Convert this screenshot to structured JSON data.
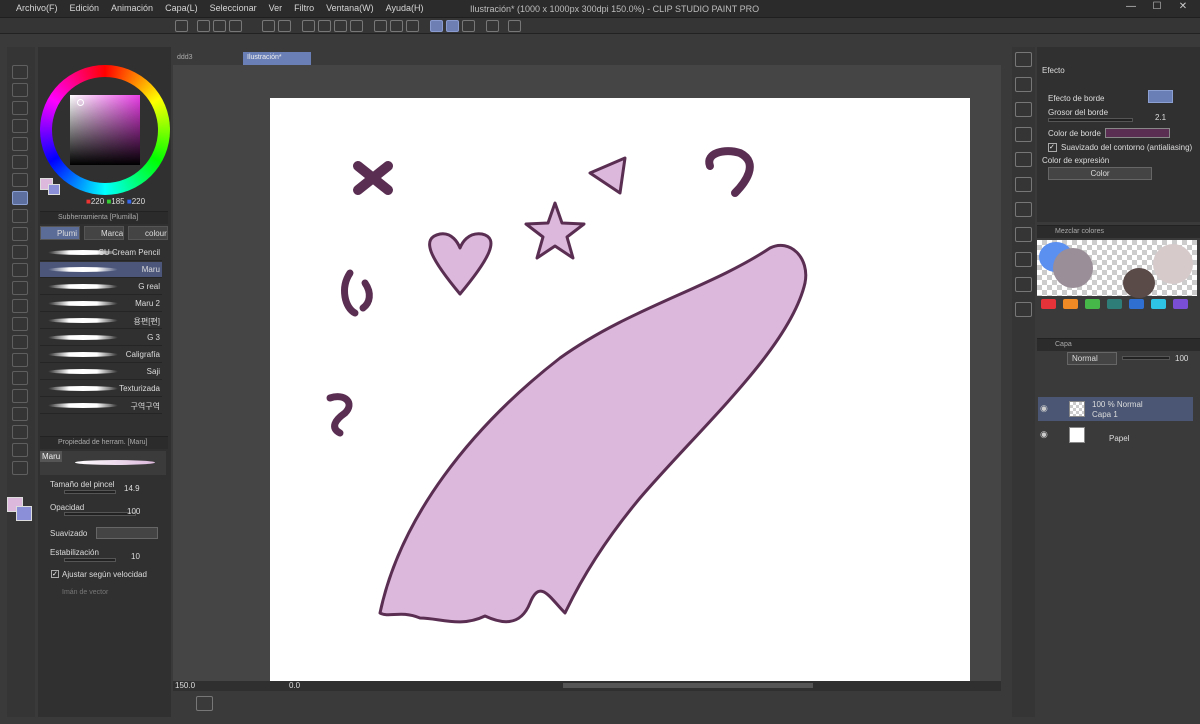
{
  "menu": [
    "Archivo(F)",
    "Edición",
    "Animación",
    "Capa(L)",
    "Seleccionar",
    "Ver",
    "Filtro",
    "Ventana(W)",
    "Ayuda(H)"
  ],
  "window_title": "Ilustración* (1000 x 1000px 300dpi 150.0%)  - CLIP STUDIO PAINT PRO",
  "color": {
    "r": "220",
    "g": "185",
    "b": "220"
  },
  "subtool_header": "Subherramienta [Plumilla]",
  "subtool_tabs": [
    "Plumi",
    "Marca",
    "colour"
  ],
  "brushes": [
    "SU Cream Pencil",
    "Maru",
    "G real",
    "Maru 2",
    "용편[편]",
    "G 3",
    "Caligrafía",
    "Saji",
    "Texturizada",
    "구역구역"
  ],
  "tool_prop_header": "Propiedad de herram. [Maru]",
  "tool_preview_name": "Maru",
  "props": {
    "size_label": "Tamaño del pincel",
    "size_value": "14.9",
    "opacity_label": "Opacidad",
    "opacity_value": "100",
    "smoothing_label": "Suavizado",
    "stab_label": "Estabilización",
    "stab_value": "10",
    "speed_label": "Ajustar según velocidad",
    "vector_label": "Imán de vector"
  },
  "doc_tabs": [
    "ddd3",
    "Ilustración*"
  ],
  "status": {
    "zoom": "150.0",
    "angle": "0.0"
  },
  "effect": {
    "header": "Efecto",
    "border_label": "Efecto de borde",
    "thickness_label": "Grosor del borde",
    "thickness_value": "2.1",
    "border_color_label": "Color de borde",
    "antialias_label": "Suavizado del contorno (antialiasing)",
    "expression_label": "Color de expresión",
    "expression_value": "Color"
  },
  "mix_header": "Mezclar colores",
  "layer_header": "Capa",
  "layers": {
    "blend": "Normal",
    "opacity": "100",
    "layer1_info": "100 % Normal",
    "layer1_name": "Capa 1",
    "paper_name": "Papel"
  },
  "colors": {
    "accent": "#6a7fb6",
    "fill": "#dcb9dc",
    "stroke": "#5a2e52",
    "palette": [
      "#e6333a",
      "#f08a24",
      "#46b84a",
      "#2f7d78",
      "#2f6fd1",
      "#2ec4e6",
      "#7a4fd6"
    ]
  }
}
